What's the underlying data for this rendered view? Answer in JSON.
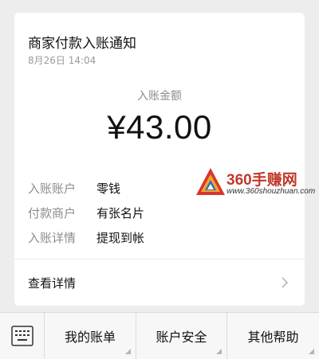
{
  "notification": {
    "title": "商家付款入账通知",
    "time": "8月26日  14:04",
    "amount_label": "入账金额",
    "amount": "¥43.00",
    "details": [
      {
        "key": "入账账户",
        "value": "零钱"
      },
      {
        "key": "付款商户",
        "value": "有张名片"
      },
      {
        "key": "入账详情",
        "value": "提现到帐"
      }
    ],
    "view_details_label": "查看详情"
  },
  "watermark": {
    "text": "360手赚网",
    "url": "www.360shouzhuan.com"
  },
  "bottom_menu": {
    "items": [
      {
        "label": "我的账单"
      },
      {
        "label": "账户安全"
      },
      {
        "label": "其他帮助"
      }
    ]
  }
}
